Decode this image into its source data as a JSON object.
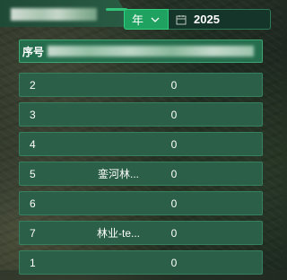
{
  "header": {
    "period_select_label": "年",
    "year_value": "2025"
  },
  "table": {
    "header_first_col": "序号",
    "rows": [
      {
        "index": "2",
        "name": "",
        "value": "0"
      },
      {
        "index": "3",
        "name": "",
        "value": "0"
      },
      {
        "index": "4",
        "name": "",
        "value": "0"
      },
      {
        "index": "5",
        "name": "銮河林...",
        "value": "0"
      },
      {
        "index": "6",
        "name": "",
        "value": "0"
      },
      {
        "index": "7",
        "name": "林业-te...",
        "value": "0"
      },
      {
        "index": "1",
        "name": "",
        "value": "0"
      }
    ]
  },
  "colors": {
    "accent": "#1fa15f",
    "row_bg": "#2b5f48",
    "header_bg": "#256e4d"
  },
  "icons": {
    "period": "chevron-down-icon",
    "date": "calendar-icon"
  }
}
